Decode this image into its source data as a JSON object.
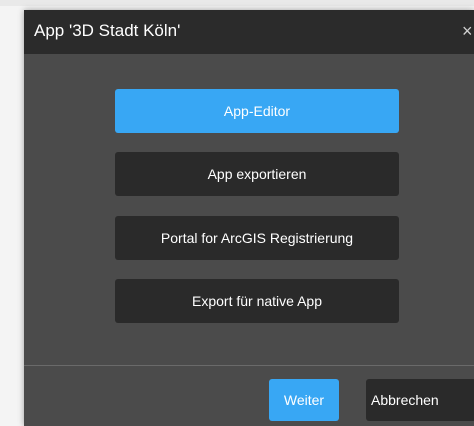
{
  "dialog": {
    "title": "App '3D Stadt Köln'",
    "close_glyph": "×"
  },
  "actions": {
    "app_editor": "App-Editor",
    "app_export": "App exportieren",
    "portal_registration": "Portal for ArcGIS Registrierung",
    "native_export": "Export für native App"
  },
  "footer": {
    "next_label": "Weiter",
    "cancel_label": "Abbrechen"
  },
  "colors": {
    "accent": "#38a7f4",
    "header": "#2b2b2b",
    "body": "#4b4b4b",
    "button_dark": "#2a2a2a"
  }
}
